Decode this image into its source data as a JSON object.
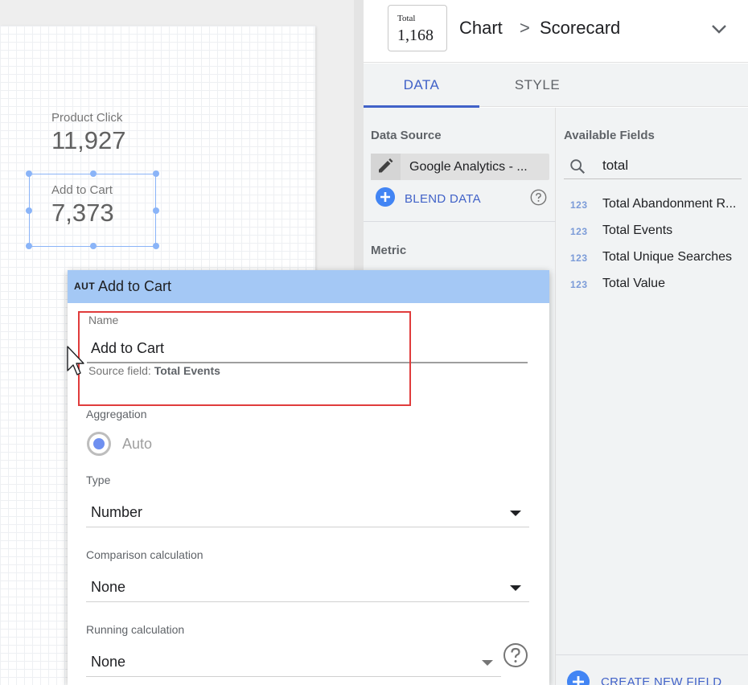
{
  "canvas": {
    "scorecards": [
      {
        "label": "Product Click",
        "value": "11,927"
      },
      {
        "label": "Add to Cart",
        "value": "7,373"
      }
    ]
  },
  "panel": {
    "thumbnail": {
      "label": "Total",
      "value": "1,168"
    },
    "breadcrumb": {
      "parent": "Chart",
      "separator": ">",
      "current": "Scorecard"
    },
    "tabs": [
      {
        "label": "DATA",
        "active": true
      },
      {
        "label": "STYLE",
        "active": false
      }
    ],
    "data_source": {
      "title": "Data Source",
      "name": "Google Analytics - ...",
      "blend_label": "BLEND DATA"
    },
    "metric_title": "Metric",
    "available_fields": {
      "title": "Available Fields",
      "search_value": "total",
      "fields": [
        {
          "type": "123",
          "name": "Total Abandonment R..."
        },
        {
          "type": "123",
          "name": "Total Events"
        },
        {
          "type": "123",
          "name": "Total Unique Searches"
        },
        {
          "type": "123",
          "name": "Total Value"
        }
      ],
      "create_label": "CREATE NEW FIELD"
    }
  },
  "editor": {
    "badge": "AUT",
    "title": "Add to Cart",
    "name_label": "Name",
    "name_value": "Add to Cart",
    "source_prefix": "Source field:",
    "source_field": "Total Events",
    "aggregation": {
      "label": "Aggregation",
      "value": "Auto"
    },
    "type": {
      "label": "Type",
      "value": "Number"
    },
    "comparison": {
      "label": "Comparison calculation",
      "value": "None"
    },
    "running": {
      "label": "Running calculation",
      "value": "None"
    }
  },
  "colors": {
    "accent": "#4162c8",
    "selection": "#8ab4f8",
    "popup_header": "#a4c8f5",
    "highlight_box": "#e03c3c",
    "plus_blue": "#4285f4"
  },
  "icons": {
    "edit": "pencil-icon",
    "blend": "plus-circle-icon",
    "help": "help-circle-icon",
    "search": "search-icon",
    "collapse": "chevron-down-icon",
    "cursor": "mouse-pointer-icon"
  }
}
